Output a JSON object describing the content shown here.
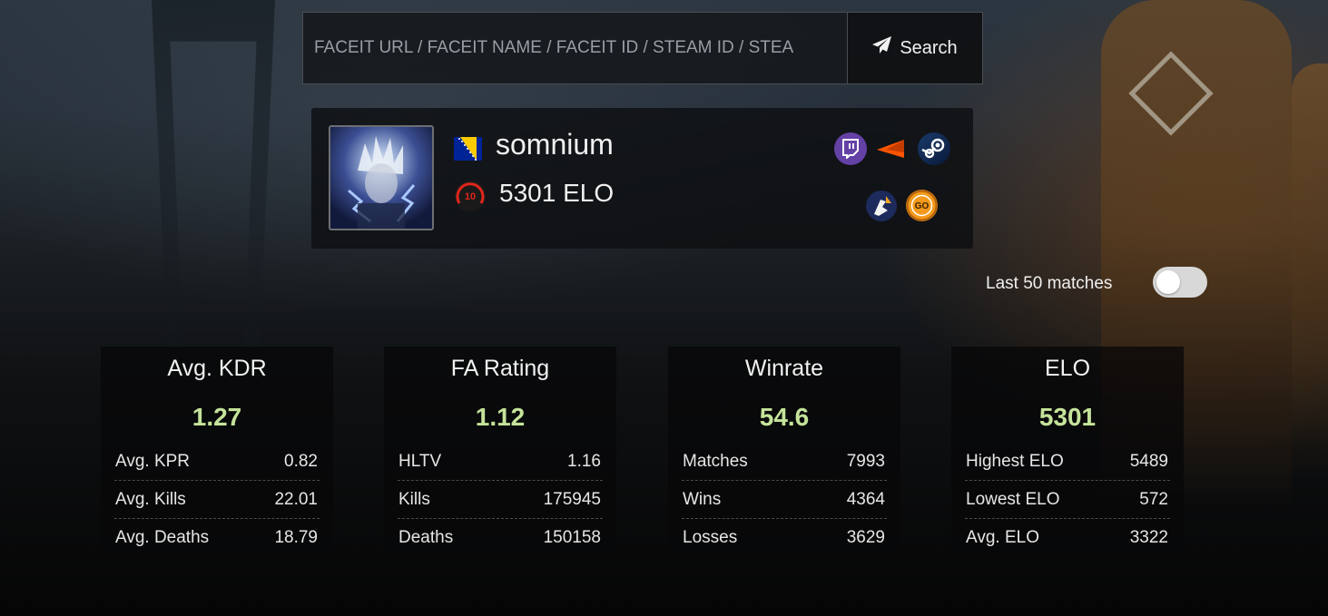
{
  "search": {
    "placeholder": "FACEIT URL / FACEIT NAME / FACEIT ID / STEAM ID / STEA",
    "button_label": "Search"
  },
  "profile": {
    "username": "somnium",
    "elo_label": "5301 ELO",
    "level": "10",
    "country": "Bosnia and Herzegovina",
    "social_icons": [
      "twitch-icon",
      "faceit-icon",
      "steam-icon",
      "esea-icon",
      "csgo-icon"
    ]
  },
  "toggle": {
    "label": "Last 50 matches",
    "on": false
  },
  "stats": [
    {
      "title": "Avg. KDR",
      "value": "1.27",
      "rows": [
        {
          "label": "Avg. KPR",
          "value": "0.82"
        },
        {
          "label": "Avg. Kills",
          "value": "22.01"
        },
        {
          "label": "Avg. Deaths",
          "value": "18.79"
        }
      ]
    },
    {
      "title": "FA Rating",
      "value": "1.12",
      "rows": [
        {
          "label": "HLTV",
          "value": "1.16"
        },
        {
          "label": "Kills",
          "value": "175945"
        },
        {
          "label": "Deaths",
          "value": "150158"
        }
      ]
    },
    {
      "title": "Winrate",
      "value": "54.6",
      "rows": [
        {
          "label": "Matches",
          "value": "7993"
        },
        {
          "label": "Wins",
          "value": "4364"
        },
        {
          "label": "Losses",
          "value": "3629"
        }
      ]
    },
    {
      "title": "ELO",
      "value": "5301",
      "rows": [
        {
          "label": "Highest ELO",
          "value": "5489"
        },
        {
          "label": "Lowest ELO",
          "value": "572"
        },
        {
          "label": "Avg. ELO",
          "value": "3322"
        }
      ]
    }
  ],
  "colors": {
    "accent_value": "#c5e39a",
    "twitch": "#6441a5",
    "faceit": "#ff5500",
    "level_ring": "#e0261b"
  }
}
